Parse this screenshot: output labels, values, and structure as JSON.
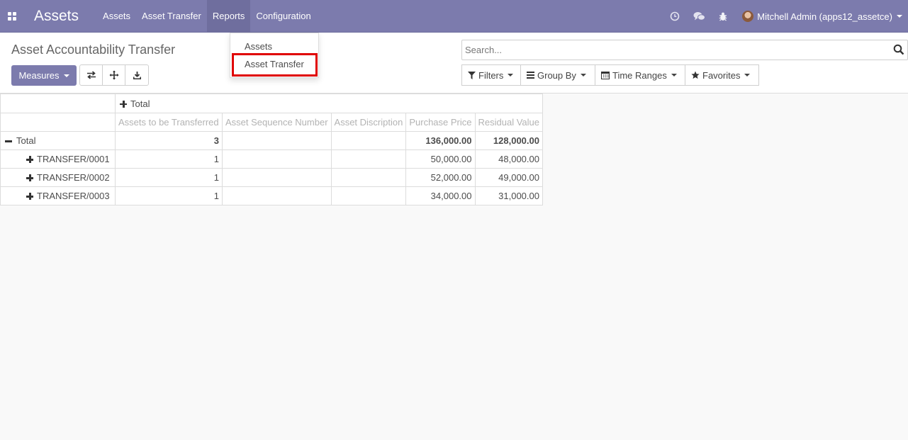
{
  "navbar": {
    "apps_icon": "apps-grid-icon",
    "brand": "Assets",
    "menu": [
      "Assets",
      "Asset Transfer",
      "Reports",
      "Configuration"
    ],
    "active_menu": "Reports",
    "user": "Mitchell Admin (apps12_assetce)",
    "system_icons": [
      "clock-icon",
      "chat-icon",
      "bug-icon"
    ],
    "bg_color": "#7c7bad"
  },
  "reports_dropdown": {
    "items": [
      "Assets",
      "Asset Transfer"
    ],
    "highlighted": "Asset Transfer",
    "highlight_color": "#e00000"
  },
  "control_panel": {
    "title": "Asset Accountability Transfer",
    "measures_label": "Measures",
    "view_buttons": [
      "flip-axis-icon",
      "expand-all-icon",
      "download-icon"
    ],
    "search_placeholder": "Search...",
    "filters_label": "Filters",
    "group_by_label": "Group By",
    "time_ranges_label": "Time Ranges",
    "favorites_label": "Favorites"
  },
  "pivot": {
    "col_group_header": "Total",
    "measures": [
      "Assets to be Transferred",
      "Asset Sequence Number",
      "Asset Discription",
      "Purchase Price",
      "Residual Value"
    ],
    "total_row": {
      "label": "Total",
      "values": [
        "3",
        "",
        "",
        "136,000.00",
        "128,000.00"
      ]
    },
    "rows": [
      {
        "label": "TRANSFER/0001",
        "values": [
          "1",
          "",
          "",
          "50,000.00",
          "48,000.00"
        ]
      },
      {
        "label": "TRANSFER/0002",
        "values": [
          "1",
          "",
          "",
          "52,000.00",
          "49,000.00"
        ]
      },
      {
        "label": "TRANSFER/0003",
        "values": [
          "1",
          "",
          "",
          "34,000.00",
          "31,000.00"
        ]
      }
    ]
  }
}
